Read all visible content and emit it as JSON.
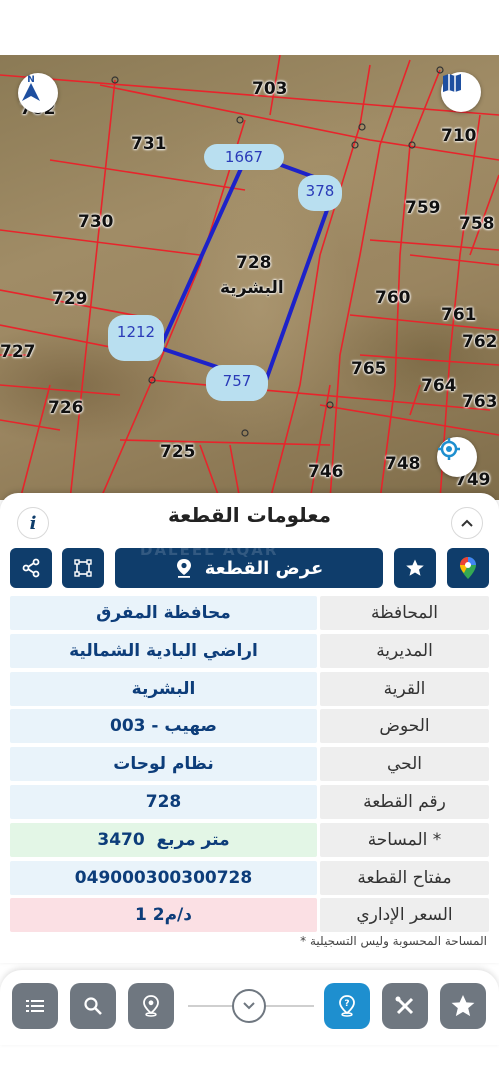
{
  "map": {
    "plot_numbers": [
      "703",
      "731",
      "710",
      "730",
      "759",
      "758",
      "728",
      "729",
      "760",
      "761",
      "727",
      "762",
      "765",
      "764",
      "726",
      "763",
      "725",
      "746",
      "748",
      "749",
      "702"
    ],
    "village_label": "البشرية",
    "edge_lengths": [
      "1667",
      "378",
      "1212",
      "757"
    ],
    "compass_letter": "N",
    "icons": {
      "compass": "north-arrow-icon",
      "map": "folded-map-icon",
      "locate": "gps-target-icon"
    },
    "colors": {
      "parcel_lines": "#e8242b",
      "selected_parcel": "#1d22c9",
      "edge_tag_bg": "#b9dff0"
    }
  },
  "panel": {
    "title": "معلومات القطعة",
    "show_plot_button": "عرض القطعة",
    "watermark": "DALEEL AQAR",
    "rows": [
      {
        "label": "المحافظة",
        "value": "محافظة المفرق"
      },
      {
        "label": "المديرية",
        "value": "اراضي البادية الشمالية"
      },
      {
        "label": "القرية",
        "value": "البشرية"
      },
      {
        "label": "الحوض",
        "value": "صهيب - 003"
      },
      {
        "label": "الحي",
        "value": "نظام لوحات"
      },
      {
        "label": "رقم القطعة",
        "value": "728"
      },
      {
        "label": "المساحة *",
        "value": "3470  متر مربع"
      },
      {
        "label": "مفتاح القطعة",
        "value": "049000300300728"
      },
      {
        "label": "السعر الإداري",
        "value": "1 د/م2"
      }
    ],
    "footnote": "* المساحة المحسوبة وليس التسجيلية",
    "colors": {
      "primary": "#0f3d6b",
      "value_text": "#0d3d7a",
      "value_bg": "#e9f3fa",
      "area_bg": "#e3f6e6",
      "price_bg": "#fbe0e4",
      "label_bg": "#eeeeee"
    }
  },
  "bottom_bar": {
    "icons": [
      "list-icon",
      "search-icon",
      "location-pin-icon",
      "chevron-down-icon",
      "help-pin-icon",
      "ruler-tools-icon",
      "star-icon"
    ],
    "active_color": "#1e8fcf",
    "button_color": "#6f7780"
  }
}
